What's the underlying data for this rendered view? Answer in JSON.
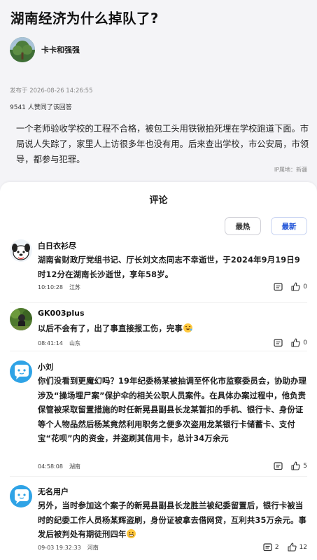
{
  "question": {
    "title": "湖南经济为什么掉队了?",
    "author": "卡卡和强强",
    "published": "发布于 2026-08-26 14:26:55",
    "agree_count": "9541 人赞同了该回答",
    "answer": "一个老师验收学校的工程不合格，被包工头用铁锹拍死埋在学校跑道下面。市局说人失踪了，家里人上访很多年也没有用。后来查出学校，市公安局，市领导，都参与犯罪。",
    "ip": "IP属地：新疆"
  },
  "comments_panel": {
    "title": "评论",
    "sort_hot": "最热",
    "sort_new": "最新",
    "accent": "#1b4fd6"
  },
  "comments": [
    {
      "name": "白日衣衫尽",
      "text": "湖南省财政厅党组书记、厅长刘文杰同志不幸逝世，于2024年9月19日9时12分在湖南长沙逝世，享年58岁。",
      "time": "10:10:28",
      "location": "江苏",
      "likes": "0",
      "replies": "",
      "avatar_icon": "cartoon-dog-avatar"
    },
    {
      "name": "GK003plus",
      "text": "以后不会有了，出了事直接报工伤，完事",
      "time": "08:41:14",
      "location": "山东",
      "likes": "0",
      "replies": "",
      "avatar_icon": "photo-avatar"
    },
    {
      "name": "小刘",
      "text": "你们没看到更魔幻吗？19年纪委杨某被抽调至怀化市监察委员会，协助办理涉及“操场埋尸案”保护伞的相关公职人员案件。在具体办案过程中，他负责保管被采取留置措施的时任新晃县副县长龙某暂扣的手机、银行卡、身份证等个人物品然后杨某竟然利用职务之便多次盗用龙某银行卡储蓄卡、支付宝“花呗”内的资金，并盗刷其信用卡，总计34万余元",
      "time": "04:58:08",
      "location": "湖南",
      "likes": "5",
      "replies": "",
      "avatar_icon": "default-bubble-avatar"
    },
    {
      "name": "无名用户",
      "text": "另外，当时参加这个案子的新晃县副县长龙胜兰被纪委留置后，银行卡被当时的纪委工作人员杨某辉盗刷，身份证被拿去借网贷，互利共35万余元。事发后被判处有期徒刑四年",
      "time": "09-03 19:32:33",
      "location": "河南",
      "likes": "12",
      "replies": "2",
      "avatar_icon": "default-bubble-avatar"
    }
  ]
}
